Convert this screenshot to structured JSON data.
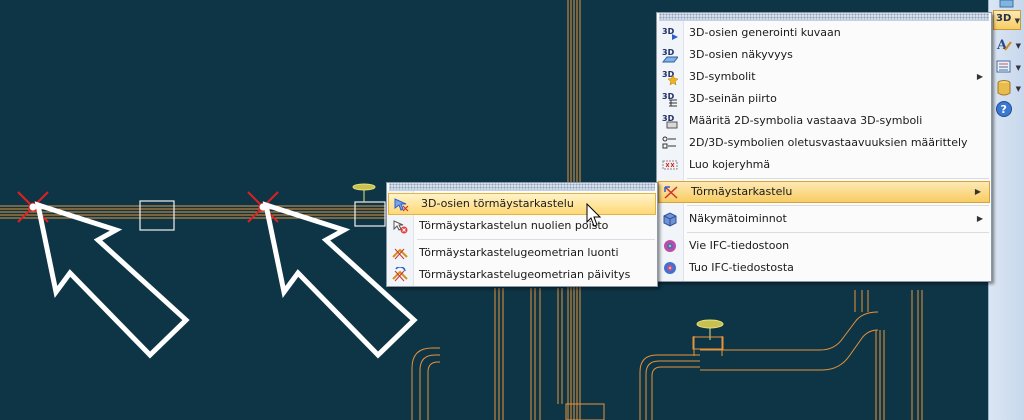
{
  "main_menu": {
    "items": [
      {
        "label": "3D-osien generointi kuvaan",
        "icon": "3d-generate-icon"
      },
      {
        "label": "3D-osien näkyvyys",
        "icon": "3d-visibility-icon"
      },
      {
        "label": "3D-symbolit",
        "icon": "3d-symbols-icon",
        "submenu": true
      },
      {
        "label": "3D-seinän piirto",
        "icon": "3d-wall-icon"
      },
      {
        "label": "Määritä 2D-symbolia vastaava 3D-symboli",
        "icon": "2d-3d-map-icon"
      },
      {
        "label": "2D/3D-symbolien oletusvastaavuuksien määrittely",
        "icon": "2d-3d-defaults-icon"
      },
      {
        "label": "Luo kojeryhmä",
        "icon": "device-group-icon"
      },
      {
        "label": "Törmäystarkastelu",
        "icon": "collision-icon",
        "submenu": true,
        "open": true
      },
      {
        "label": "Näkymätoiminnot",
        "icon": "view-functions-icon",
        "submenu": true
      },
      {
        "label": "Vie IFC-tiedostoon",
        "icon": "ifc-export-icon"
      },
      {
        "label": "Tuo IFC-tiedostosta",
        "icon": "ifc-import-icon"
      }
    ]
  },
  "sub_menu": {
    "items": [
      {
        "label": "3D-osien törmäystarkastelu",
        "icon": "collision-check-icon",
        "highlighted": true
      },
      {
        "label": "Törmäystarkastelun nuolien poisto",
        "icon": "remove-arrows-icon"
      },
      {
        "label": "Törmäystarkastelugeometrian luonti",
        "icon": "create-geometry-icon"
      },
      {
        "label": "Törmäystarkastelugeometrian päivitys",
        "icon": "update-geometry-icon"
      }
    ]
  },
  "toolbar": {
    "active_label": "3D"
  },
  "colors": {
    "canvas_bg": "#0e3546",
    "pipe": "#e8923a",
    "highlight": "#ffd877"
  }
}
